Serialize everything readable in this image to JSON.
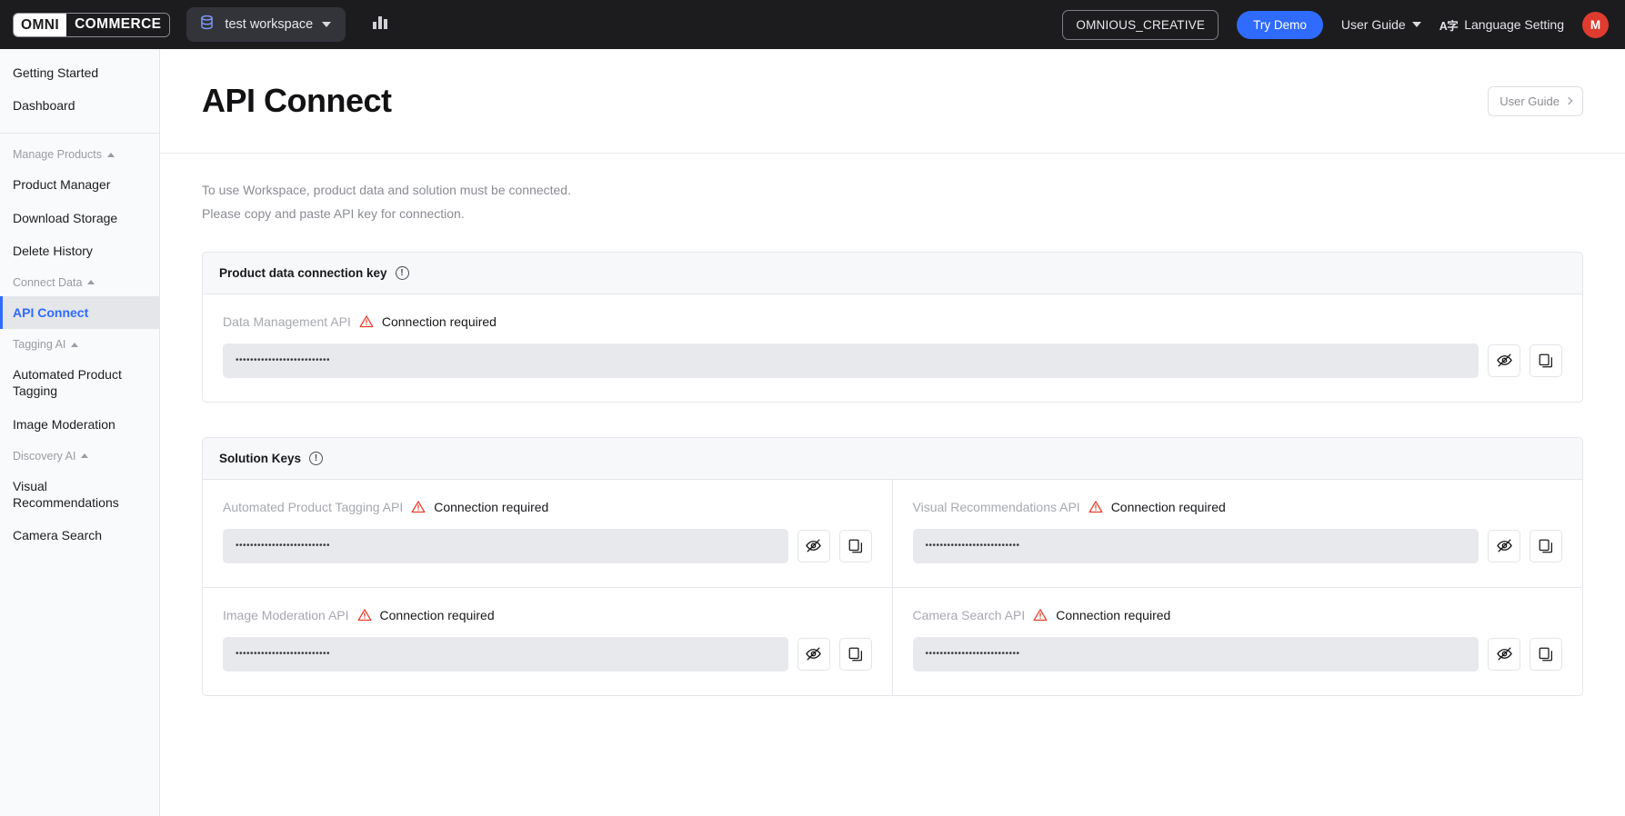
{
  "topbar": {
    "logo_left": "OMNI",
    "logo_right": "COMMERCE",
    "workspace_name": "test workspace",
    "chart_icon": "bar-chart-icon",
    "org_label": "OMNIOUS_CREATIVE",
    "try_demo_label": "Try Demo",
    "user_guide_label": "User Guide",
    "translate_icon": "A字",
    "language_setting_label": "Language Setting",
    "avatar_initial": "M",
    "avatar_color": "#e03b2f",
    "accent_color": "#2f6bff"
  },
  "sidebar": {
    "top_items": [
      {
        "label": "Getting Started",
        "active": false
      },
      {
        "label": "Dashboard",
        "active": false
      }
    ],
    "sections": [
      {
        "title": "Manage Products",
        "items": [
          {
            "label": "Product Manager",
            "active": false
          },
          {
            "label": "Download Storage",
            "active": false
          },
          {
            "label": "Delete History",
            "active": false
          }
        ]
      },
      {
        "title": "Connect Data",
        "items": [
          {
            "label": "API Connect",
            "active": true
          }
        ]
      },
      {
        "title": "Tagging AI",
        "items": [
          {
            "label": "Automated Product Tagging",
            "active": false
          },
          {
            "label": "Image Moderation",
            "active": false
          }
        ]
      },
      {
        "title": "Discovery AI",
        "items": [
          {
            "label": "Visual Recommendations",
            "active": false
          },
          {
            "label": "Camera Search",
            "active": false
          }
        ]
      }
    ]
  },
  "page": {
    "title": "API Connect",
    "guide_button_label": "User Guide",
    "intro_line1": "To use Workspace, product data and solution must be connected.",
    "intro_line2": "Please copy and paste API key for connection."
  },
  "product_key_card": {
    "header_title": "Product data connection key",
    "info_icon": "info-circle-icon",
    "key": {
      "label": "Data Management API",
      "status": "Connection required",
      "status_icon": "warning-triangle-icon",
      "status_color": "#e8402a",
      "masked_value": "••••••••••••••••••••••••••",
      "toggle_icon": "eye-off-icon",
      "copy_icon": "copy-icon"
    }
  },
  "solution_keys_card": {
    "header_title": "Solution Keys",
    "info_icon": "info-circle-icon",
    "keys": [
      {
        "label": "Automated Product Tagging API",
        "status": "Connection required",
        "status_icon": "warning-triangle-icon",
        "masked_value": "••••••••••••••••••••••••••",
        "toggle_icon": "eye-off-icon",
        "copy_icon": "copy-icon"
      },
      {
        "label": "Visual Recommendations API",
        "status": "Connection required",
        "status_icon": "warning-triangle-icon",
        "masked_value": "••••••••••••••••••••••••••",
        "toggle_icon": "eye-off-icon",
        "copy_icon": "copy-icon"
      },
      {
        "label": "Image Moderation API",
        "status": "Connection required",
        "status_icon": "warning-triangle-icon",
        "masked_value": "••••••••••••••••••••••••••",
        "toggle_icon": "eye-off-icon",
        "copy_icon": "copy-icon"
      },
      {
        "label": "Camera Search API",
        "status": "Connection required",
        "status_icon": "warning-triangle-icon",
        "masked_value": "••••••••••••••••••••••••••",
        "toggle_icon": "eye-off-icon",
        "copy_icon": "copy-icon"
      }
    ]
  }
}
